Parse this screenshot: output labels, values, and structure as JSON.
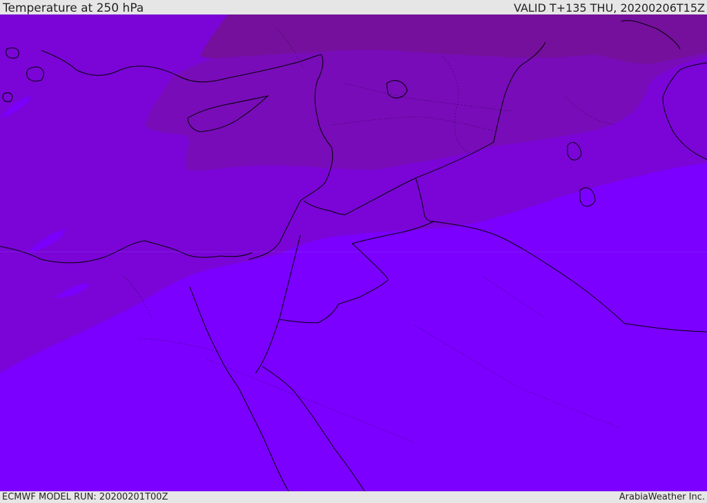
{
  "header": {
    "title": "Temperature at 250 hPa",
    "valid": "VALID T+135 THU, 20200206T15Z"
  },
  "footer": {
    "model_run": "ECMWF MODEL RUN: 20200201T00Z",
    "credit": "ArabiaWeather Inc."
  },
  "colors": {
    "band_warm": "#7b00ff",
    "band_mid": "#7a05d6",
    "band_cool": "#780cb8",
    "band_cold": "#74109c",
    "coastline": "#000000"
  }
}
